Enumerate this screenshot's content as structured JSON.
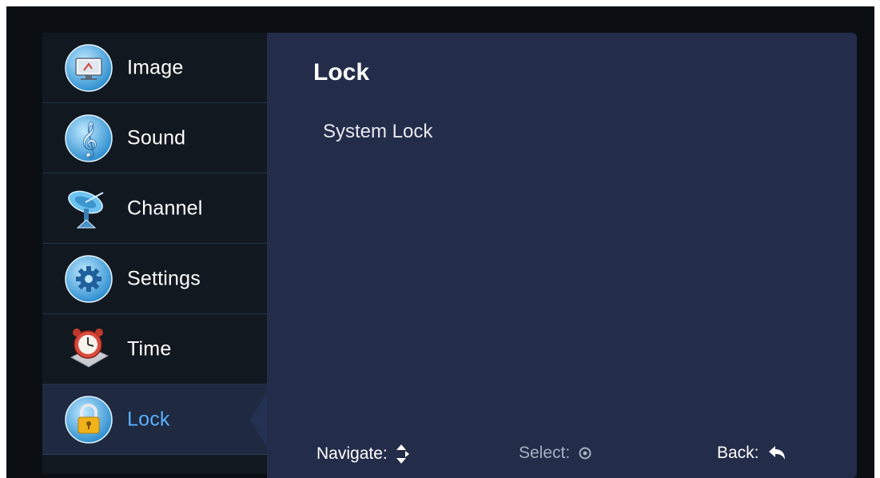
{
  "sidebar": {
    "items": [
      {
        "label": "Image",
        "icon": "monitor-icon"
      },
      {
        "label": "Sound",
        "icon": "music-note-icon"
      },
      {
        "label": "Channel",
        "icon": "satellite-dish-icon"
      },
      {
        "label": "Settings",
        "icon": "gear-icon"
      },
      {
        "label": "Time",
        "icon": "alarm-clock-icon"
      },
      {
        "label": "Lock",
        "icon": "padlock-icon",
        "active": true
      }
    ]
  },
  "panel": {
    "title": "Lock",
    "items": [
      {
        "label": "System Lock"
      }
    ]
  },
  "footer": {
    "navigate_label": "Navigate:",
    "select_label": "Select:",
    "back_label": "Back:"
  },
  "colors": {
    "background": "#0b0f14",
    "sidebar": "#111820",
    "panel": "#232c48",
    "active_item": "#1f2940",
    "active_label": "#5ab0ff"
  }
}
